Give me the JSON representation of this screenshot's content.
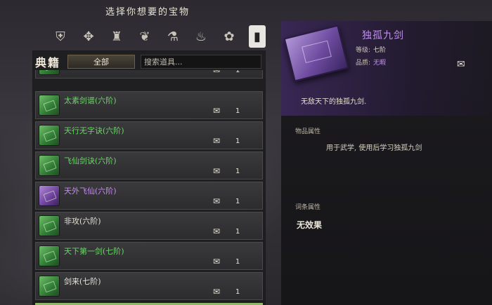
{
  "header": {
    "title": "选择你想要的宝物"
  },
  "category_tabs": [
    {
      "icon": "armor-icon",
      "glyph": "⛨"
    },
    {
      "icon": "weapon-icon",
      "glyph": "✥"
    },
    {
      "icon": "robe-icon",
      "glyph": "♜"
    },
    {
      "icon": "accessory-icon",
      "glyph": "❦"
    },
    {
      "icon": "medicine-icon",
      "glyph": "⚗"
    },
    {
      "icon": "herb-icon",
      "glyph": "♨"
    },
    {
      "icon": "material-icon",
      "glyph": "✿"
    },
    {
      "icon": "book-icon",
      "glyph": "▮"
    }
  ],
  "inventory": {
    "section_label": "典籍",
    "filter_label": "全部",
    "search_placeholder": "搜索道具...",
    "partial_top_qty": "1",
    "items": [
      {
        "name": "太素剑谱(六阶)",
        "qty": "1",
        "color": "green"
      },
      {
        "name": "天行无字诀(六阶)",
        "qty": "1",
        "color": "green"
      },
      {
        "name": "飞仙剑诀(六阶)",
        "qty": "1",
        "color": "green"
      },
      {
        "name": "天外飞仙(六阶)",
        "qty": "1",
        "color": "purple"
      },
      {
        "name": "非攻(六阶)",
        "qty": "1",
        "color": "white"
      },
      {
        "name": "天下第一剑(七阶)",
        "qty": "1",
        "color": "green"
      },
      {
        "name": "剑来(七阶)",
        "qty": "1",
        "color": "white"
      }
    ]
  },
  "detail": {
    "title": "独孤九剑",
    "level_label": "等级:",
    "level_value": "七阶",
    "quality_label": "品质:",
    "quality_value": "无暇",
    "description": "无敌天下的独孤九剑.",
    "item_attr_label": "物品属性",
    "item_attr_text": "用于武学, 使用后学习独孤九剑",
    "entry_attr_label": "词条属性",
    "entry_attr_text": "无效果"
  }
}
